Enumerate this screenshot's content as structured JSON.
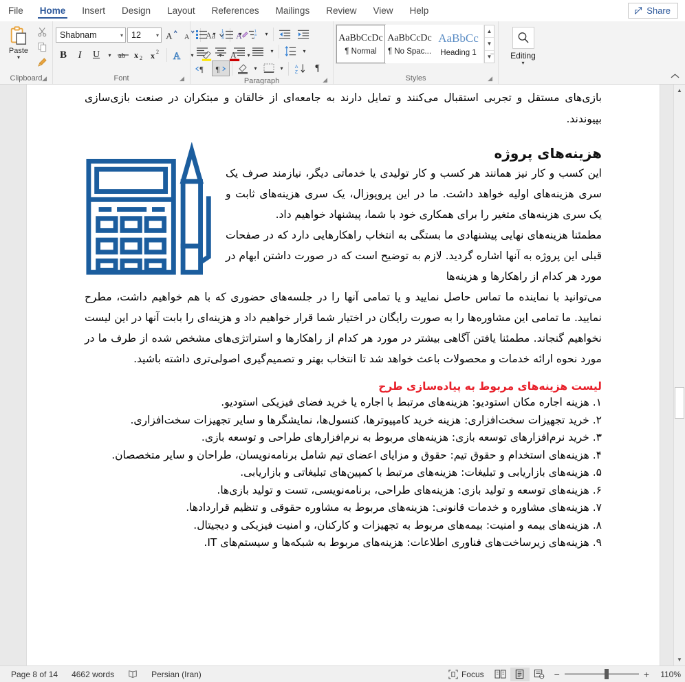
{
  "tabs": [
    {
      "label": "File",
      "active": false
    },
    {
      "label": "Home",
      "active": true
    },
    {
      "label": "Insert",
      "active": false
    },
    {
      "label": "Design",
      "active": false
    },
    {
      "label": "Layout",
      "active": false
    },
    {
      "label": "References",
      "active": false
    },
    {
      "label": "Mailings",
      "active": false
    },
    {
      "label": "Review",
      "active": false
    },
    {
      "label": "View",
      "active": false
    },
    {
      "label": "Help",
      "active": false
    }
  ],
  "share": {
    "label": "Share",
    "icon": "share-icon"
  },
  "ribbon": {
    "clipboard": {
      "label": "Clipboard",
      "paste_label": "Paste",
      "paste_icon": "paste-icon",
      "cut_icon": "scissors-icon",
      "copy_icon": "copy-icon",
      "format_painter_icon": "format-painter-icon",
      "launcher": "dialog-launcher-icon"
    },
    "font": {
      "label": "Font",
      "font_name": "Shabnam",
      "font_size": "12",
      "grow_font_icon": "grow-font-icon",
      "shrink_font_icon": "shrink-font-icon",
      "change_case_icon": "change-case-icon",
      "clear_formatting_icon": "clear-formatting-icon",
      "bold_label": "B",
      "italic_label": "I",
      "underline_label": "U",
      "strikethrough_icon": "strikethrough-icon",
      "subscript_label": "x",
      "superscript_label": "x",
      "text_effects_icon": "text-effects-icon",
      "highlight_icon": "highlight-color-icon",
      "font_color_icon": "font-color-icon",
      "launcher": "dialog-launcher-icon"
    },
    "paragraph": {
      "label": "Paragraph",
      "bullets_icon": "bullet-list-icon",
      "numbering_icon": "numbered-list-icon",
      "multilevel_icon": "multilevel-list-icon",
      "decrease_indent_icon": "decrease-indent-icon",
      "increase_indent_icon": "increase-indent-icon",
      "align_left_icon": "align-left-icon",
      "align_center_icon": "align-center-icon",
      "align_right_icon": "align-right-icon",
      "justify_icon": "justify-icon",
      "line_spacing_icon": "line-spacing-icon",
      "ltr_icon": "left-to-right-icon",
      "rtl_icon": "right-to-left-icon",
      "shading_icon": "shading-icon",
      "borders_icon": "borders-icon",
      "sort_icon": "sort-icon",
      "show_marks_icon": "show-formatting-marks-icon",
      "launcher": "dialog-launcher-icon"
    },
    "styles": {
      "label": "Styles",
      "items": [
        {
          "preview": "AaBbCcDc",
          "name": "¶ Normal",
          "selected": true
        },
        {
          "preview": "AaBbCcDc",
          "name": "¶ No Spac...",
          "selected": false
        },
        {
          "preview": "AaBbCс",
          "name": "Heading 1",
          "selected": false
        }
      ],
      "scroll_up_icon": "scroll-up-icon",
      "scroll_down_icon": "scroll-down-icon",
      "more_icon": "more-styles-icon",
      "launcher": "dialog-launcher-icon"
    },
    "editing": {
      "label": "Editing",
      "icon": "search-icon",
      "caret": "chevron-down-icon"
    },
    "collapse_icon": "collapse-ribbon-icon"
  },
  "document": {
    "top_paragraph": "بازی‌های مستقل و تجربی استقبال می‌کنند و تمایل دارند به جامعه‌ای از خالقان و مبتکران در صنعت بازی‌سازی بپیوندند.",
    "heading": "هزینه‌های پروژه",
    "icon_name": "calculator-and-pencil-icon",
    "icon_color": "#1b5d9e",
    "para1": "این کسب و کار نیز همانند هر کسب و کار تولیدی یا خدماتی دیگر، نیازمند صرف یک سری هزینه‌های اولیه خواهد داشت. ما در این پروپوزال، یک سری هزینه‌های ثابت و یک سری هزینه‌های متغیر را برای همکاری خود با شما، پیشنهاد خواهیم داد.",
    "para2_narrow": "مطمئنا هزینه‌های نهایی پیشنهادی ما بستگی به انتخاب راهکارهایی دارد که در صفحات قبلی این پروژه به آنها اشاره گردید. لازم به توضیح است که در صورت داشتن ابهام در مورد هر کدام از راهکارها و هزینه‌ها",
    "para2_full": "می‌توانید با نماینده ما تماس حاصل نمایید و یا تمامی آنها را در جلسه‌های حضوری که با هم خواهیم داشت، مطرح نمایید. ما تمامی این مشاوره‌ها را به صورت رایگان در اختیار شما قرار خواهیم داد و هزینه‌ای را بابت آنها در این لیست نخواهیم گنجاند. مطمئنا یافتن آگاهی بیشتر در مورد هر کدام از راهکارها و استراتژی‌های مشخص شده از طرف ما در مورد نحوه ارائه خدمات و محصولات باعث خواهد شد تا انتخاب بهتر و تصمیم‌گیری اصولی‌تری داشته باشید.",
    "red_heading": "لیست هزینه‌های مربوط به پیاده‌سازی طرح",
    "red_heading_color": "#e8202a",
    "cost_list": [
      "۱. هزینه اجاره مکان استودیو: هزینه‌های مرتبط با اجاره یا خرید فضای فیزیکی استودیو.",
      "۲. خرید تجهیزات سخت‌افزاری: هزینه خرید کامپیوترها، کنسول‌ها، نمایشگرها و سایر تجهیزات سخت‌افزاری.",
      "۳. خرید نرم‌افزارهای توسعه بازی: هزینه‌های مربوط به نرم‌افزارهای طراحی و توسعه بازی.",
      "۴. هزینه‌های استخدام و حقوق تیم: حقوق و مزایای اعضای تیم شامل برنامه‌نویسان، طراحان و سایر متخصصان.",
      "۵. هزینه‌های بازاریابی و تبلیغات: هزینه‌های مرتبط با کمپین‌های تبلیغاتی و بازاریابی.",
      "۶. هزینه‌های توسعه و تولید بازی: هزینه‌های طراحی، برنامه‌نویسی، تست و تولید بازی‌ها.",
      "۷. هزینه‌های مشاوره و خدمات قانونی: هزینه‌های مربوط به مشاوره حقوقی و تنظیم قراردادها.",
      "۸. هزینه‌های بیمه و امنیت: بیمه‌های مربوط به تجهیزات و کارکنان، و امنیت فیزیکی و دیجیتال.",
      "۹. هزینه‌های زیرساخت‌های فناوری اطلاعات: هزینه‌های مربوط به شبکه‌ها و سیستم‌های IT."
    ]
  },
  "statusbar": {
    "page": "Page 8 of 14",
    "words": "4662 words",
    "proofing_icon": "proofing-errors-icon",
    "language": "Persian (Iran)",
    "focus_label": "Focus",
    "focus_icon": "focus-mode-icon",
    "read_mode_icon": "read-mode-icon",
    "print_layout_icon": "print-layout-icon",
    "web_layout_icon": "web-layout-icon",
    "zoom_out": "−",
    "zoom_in": "+",
    "zoom_value": "110%"
  }
}
